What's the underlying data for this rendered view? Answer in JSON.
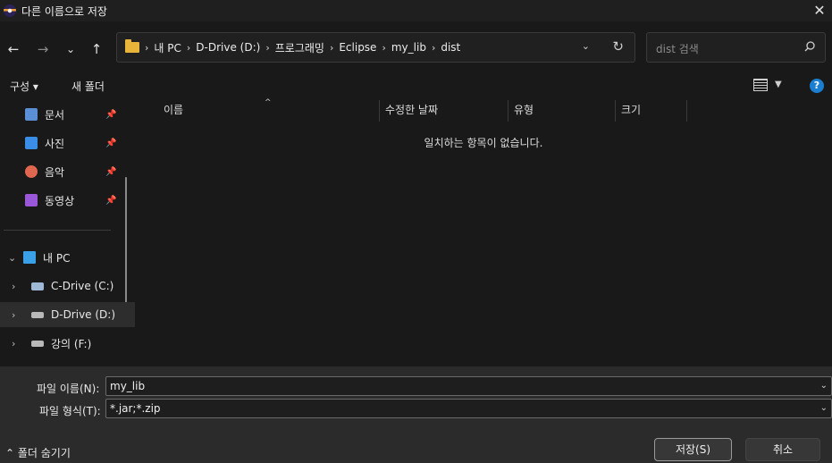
{
  "window": {
    "title": "다른 이름으로 저장",
    "close_glyph": "✕"
  },
  "nav": {
    "back": "←",
    "forward": "→",
    "recent": "⌄",
    "up": "↑",
    "breadcrumb": [
      "내 PC",
      "D-Drive (D:)",
      "프로그래밍",
      "Eclipse",
      "my_lib",
      "dist"
    ],
    "separator": "›",
    "dropdown": "⌄",
    "refresh": "↻",
    "search_placeholder": "dist 검색"
  },
  "toolbar": {
    "organize": "구성 ▾",
    "new_folder": "새 폴더",
    "view_dd": "▼",
    "help": "?"
  },
  "sidebar": {
    "items": [
      {
        "label": "문서",
        "icon": "document-icon",
        "color": "#5b8fd6",
        "pinned": true
      },
      {
        "label": "사진",
        "icon": "photo-icon",
        "color": "#3a8ee6",
        "pinned": true
      },
      {
        "label": "음악",
        "icon": "music-icon",
        "color": "#e0674f",
        "pinned": true
      },
      {
        "label": "동영상",
        "icon": "video-icon",
        "color": "#9a58d8",
        "pinned": true
      }
    ],
    "pc": {
      "label": "내 PC",
      "chevron": "⌄"
    },
    "drives": [
      {
        "label": "C-Drive (C:)",
        "chevron": "›"
      },
      {
        "label": "D-Drive (D:)",
        "chevron": "›",
        "selected": true
      },
      {
        "label": "강의 (F:)",
        "chevron": "›"
      }
    ],
    "pin_glyph": "📌"
  },
  "list": {
    "columns": [
      "이름",
      "수정한 날짜",
      "유형",
      "크기"
    ],
    "sort_glyph": "^",
    "empty_message": "일치하는 항목이 없습니다."
  },
  "bottom": {
    "filename_label": "파일 이름(N):",
    "filename_value": "my_lib",
    "filetype_label": "파일 형식(T):",
    "filetype_value": "*.jar;*.zip",
    "dd": "⌄",
    "hide_folders": "⌃ 폴더 숨기기",
    "save_button": "저장(S)",
    "cancel_button": "취소"
  }
}
